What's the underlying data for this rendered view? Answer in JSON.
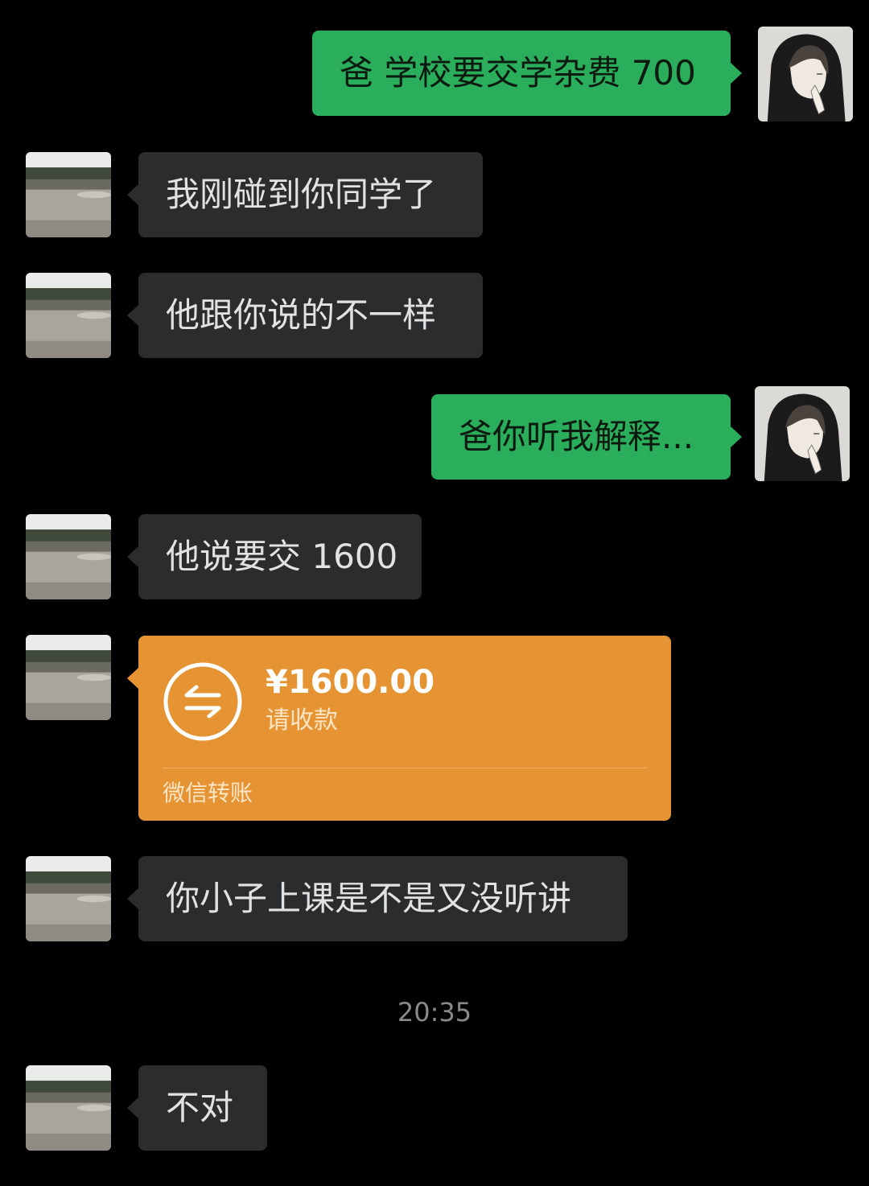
{
  "messages": [
    {
      "from": "me",
      "text": "爸 学校要交学杂费 700"
    },
    {
      "from": "dad",
      "text": "我刚碰到你同学了"
    },
    {
      "from": "dad",
      "text": "他跟你说的不一样"
    },
    {
      "from": "me",
      "text": "爸你听我解释..."
    },
    {
      "from": "dad",
      "text": "他说要交 1600"
    },
    {
      "from": "dad",
      "type": "transfer",
      "amount": "¥1600.00",
      "status": "请收款",
      "label": "微信转账"
    },
    {
      "from": "dad",
      "text": "你小子上课是不是又没听讲"
    },
    {
      "from": "dad",
      "text": "不对"
    }
  ],
  "timestamp": "20:35",
  "colors": {
    "background": "#000000",
    "outgoing_bubble": "#2bae5c",
    "incoming_bubble": "#2b2c2e",
    "transfer_card": "#e69433"
  },
  "icons": {
    "my_avatar": "anime-boy-hood-avatar",
    "dad_avatar": "landscape-photo-avatar",
    "transfer": "transfer-arrows-icon"
  }
}
